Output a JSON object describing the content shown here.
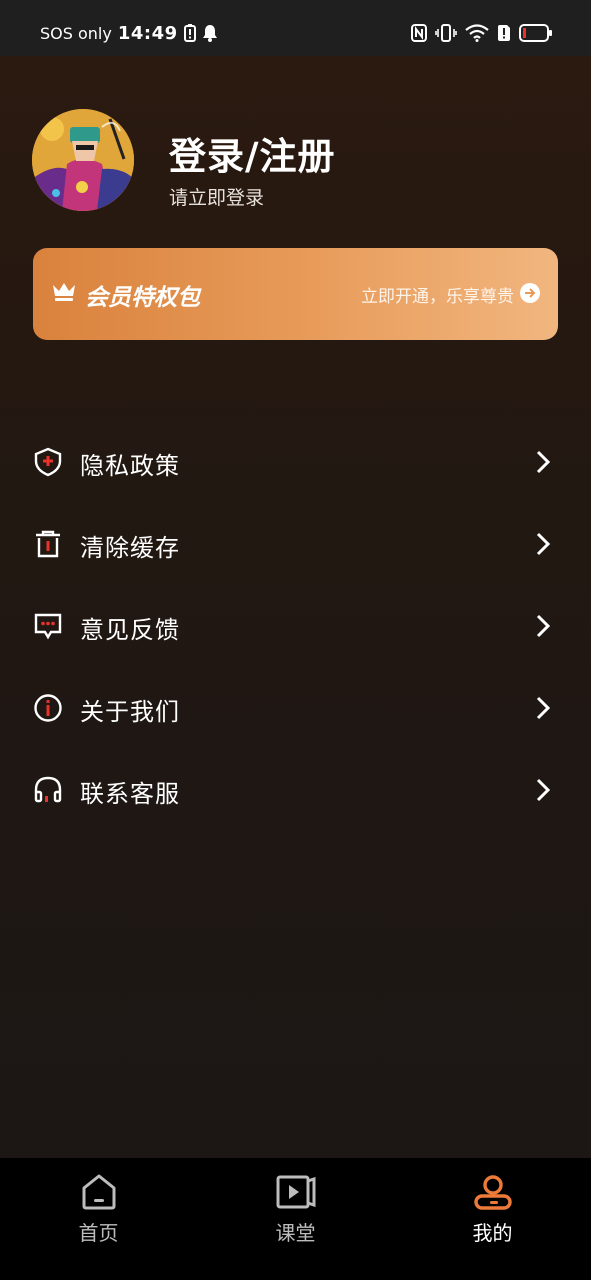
{
  "status_bar": {
    "carrier": "SOS only",
    "time": "14:49"
  },
  "profile": {
    "title": "登录/注册",
    "subtitle": "请立即登录"
  },
  "vip": {
    "title": "会员特权包",
    "action": "立即开通，乐享尊贵"
  },
  "menu": {
    "items": [
      {
        "label": "隐私政策",
        "icon": "shield-icon"
      },
      {
        "label": "清除缓存",
        "icon": "trash-icon"
      },
      {
        "label": "意见反馈",
        "icon": "message-icon"
      },
      {
        "label": "关于我们",
        "icon": "info-icon"
      },
      {
        "label": "联系客服",
        "icon": "headset-icon"
      }
    ]
  },
  "tabbar": {
    "tabs": [
      {
        "label": "首页",
        "icon": "home-icon"
      },
      {
        "label": "课堂",
        "icon": "video-icon"
      },
      {
        "label": "我的",
        "icon": "profile-icon",
        "active": true
      }
    ]
  },
  "colors": {
    "accent": "#ee7a3a",
    "vip_start": "#d9823d",
    "vip_end": "#f1b67f",
    "icon_red": "#e8322b"
  }
}
